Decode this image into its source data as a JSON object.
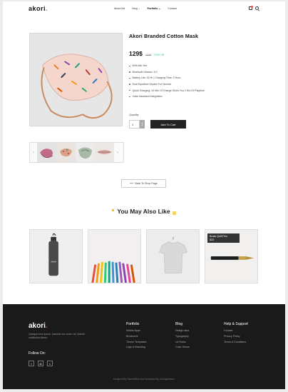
{
  "header": {
    "logo": "akori",
    "logo_dot": ".",
    "nav": [
      "About Me",
      "Blog",
      "Portfolio",
      "Contact"
    ],
    "icons": [
      "cart-icon",
      "search-icon"
    ]
  },
  "product": {
    "title": "Akori Branded Cotton Mask",
    "price": "129$",
    "old_price": "159$",
    "discount": "20% Off",
    "features": [
      "With Mic Yes",
      "Bluetooth Version: 5.0",
      "Battery Life: 30 Hr | Charging Time: 2 Hour",
      "Dual Equalizer Modes For Normal",
      "Quick Charging: 10 Min Of Charge Gives You 2 Hrs Of Playtime",
      "Voice Assistant Integration"
    ],
    "quantity_label": "Quantity",
    "quantity_value": "1",
    "add_to_cart": "Add To Cart"
  },
  "back_button": "Back To Shop Page",
  "also_like": {
    "title": "You May Also Like",
    "tooltip_line1": "Brass Quill Pen",
    "tooltip_line2": "$23"
  },
  "footer": {
    "logo": "akori",
    "logo_dot": ".",
    "description": "Quisque sem ipsum, placerat nec tortor vel, blandit vestibulum libero.",
    "follow": "Follow On:",
    "social_icons": [
      "twitter-icon",
      "instagram-icon",
      "rss-icon"
    ],
    "columns": [
      {
        "title": "Portfolio",
        "links": [
          "Mobile Apps",
          "Brochures",
          "Theme Templates",
          "Logo & Branding"
        ]
      },
      {
        "title": "Blog",
        "links": [
          "Design Idea",
          "Typography",
          "Ux Rules",
          "Color Sense"
        ]
      },
      {
        "title": "Help & Support",
        "links": [
          "Contact",
          "Privacy Policy",
          "Terms & Conditions"
        ]
      }
    ],
    "copyright": "Designed By ThemeMiner And Developed By Gothugetheme"
  },
  "colors": {
    "accent": "#e74c3c",
    "discount": "#2ecc71",
    "footer_bg": "#1a1a1a",
    "highlight": "#f1c40f"
  }
}
